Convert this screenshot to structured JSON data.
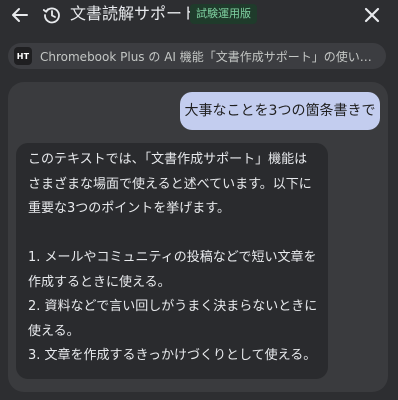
{
  "header": {
    "title": "文書読解サポート",
    "badge": "試験運用版",
    "back_icon": "arrow-left-icon",
    "history_icon": "history-icon",
    "close_icon": "close-icon"
  },
  "source": {
    "favicon_text": "HT",
    "title": "Chromebook Plus の AI 機能「文書作成サポート」の使い方と活用方…"
  },
  "chat": {
    "user_message": "大事なことを3つの箇条書きで",
    "response": {
      "intro_lines": [
        "このテキストでは、「文書作成サポート」機能は",
        "さまざまな場面で使えると述べています。以下に",
        "重要な3つのポイントを挙げます。"
      ],
      "items": [
        "1. メールやコミュニティの投稿などで短い文章を",
        "作成するときに使える。",
        "2. 資料などで言い回しがうまく決まらないときに",
        "使える。",
        "3. 文章を作成するきっかけづくりとして使える。"
      ]
    }
  },
  "colors": {
    "background": "#2d2e31",
    "panel": "#3a3b3e",
    "user_bubble": "#c3cdef",
    "badge_bg": "#1f3b2b",
    "badge_text": "#7fd1a1"
  }
}
